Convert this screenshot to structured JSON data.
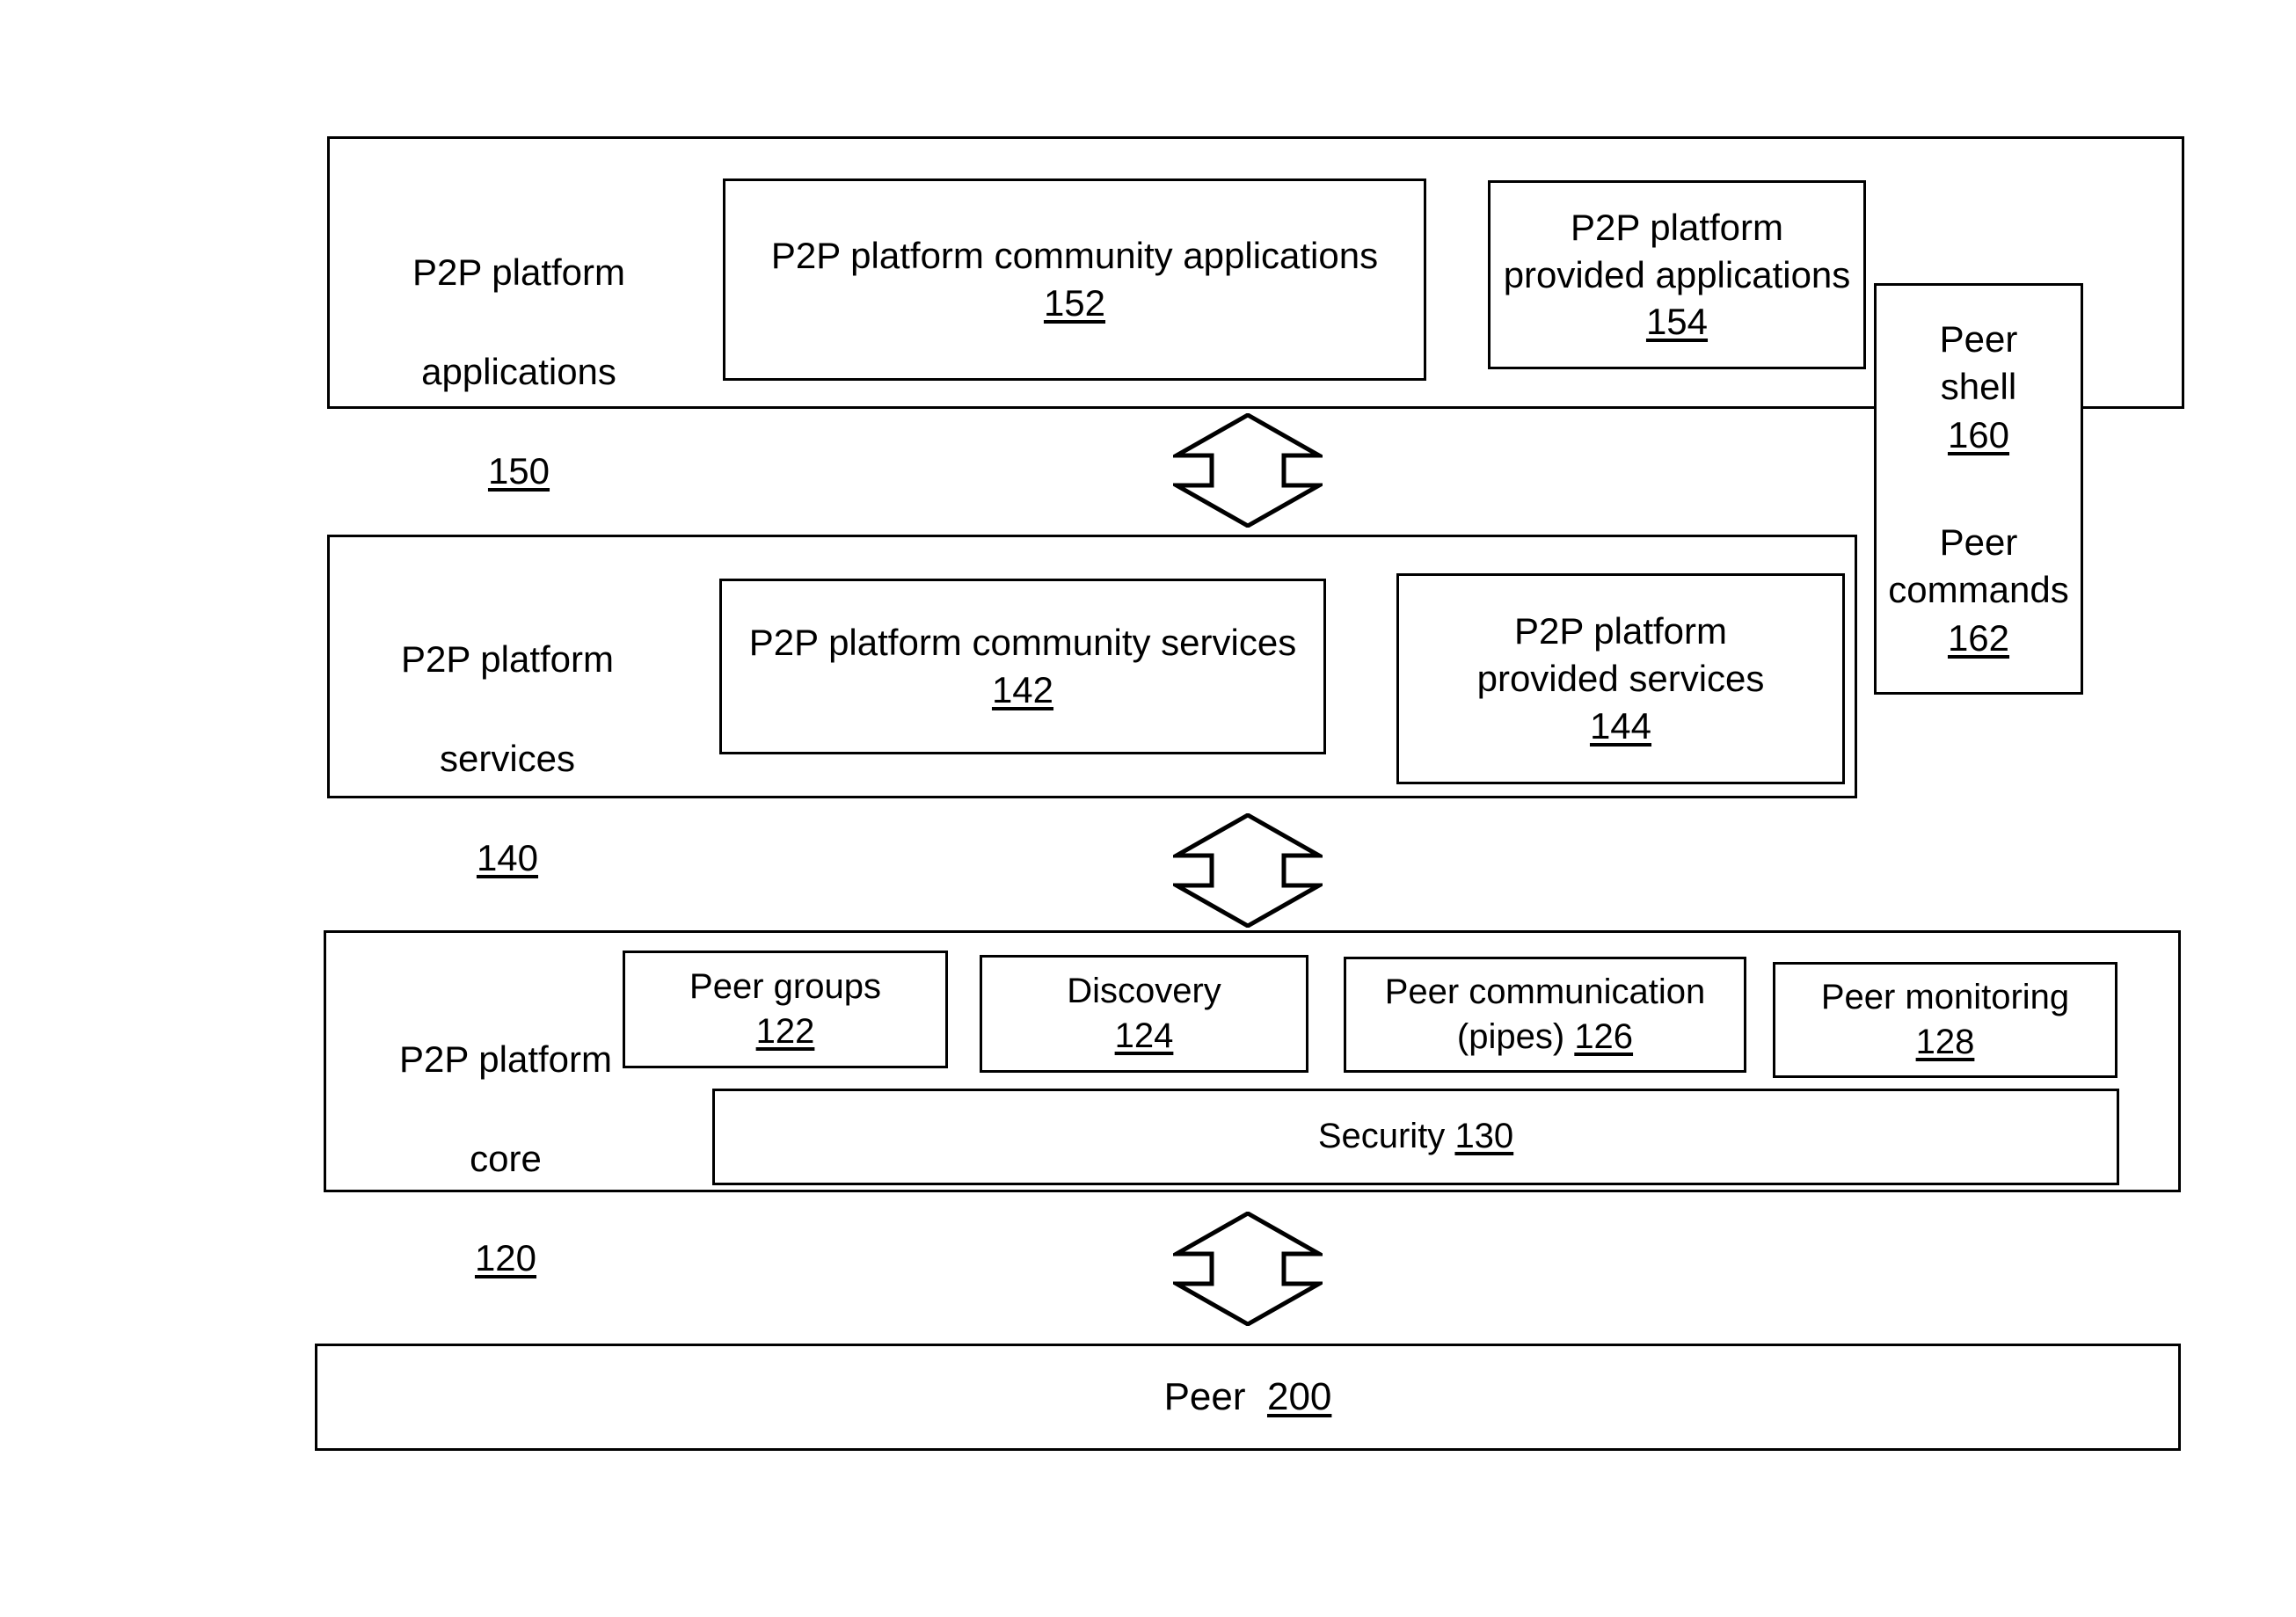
{
  "figure": {
    "type": "layered-architecture-block-diagram",
    "domain": "patent-figure"
  },
  "layers": {
    "applications": {
      "title_line1": "P2P platform",
      "title_line2": "applications",
      "ref": "150",
      "children": [
        {
          "name": "community-applications",
          "label": "P2P platform community applications",
          "ref": "152"
        },
        {
          "name": "provided-applications",
          "label_line1": "P2P platform",
          "label_line2": "provided applications",
          "ref": "154"
        }
      ]
    },
    "services": {
      "title_line1": "P2P platform",
      "title_line2": "services",
      "ref": "140",
      "children": [
        {
          "name": "community-services",
          "label": "P2P platform community services",
          "ref": "142"
        },
        {
          "name": "provided-services",
          "label_line1": "P2P platform",
          "label_line2": "provided services",
          "ref": "144"
        }
      ]
    },
    "core": {
      "title_line1": "P2P platform",
      "title_line2": "core",
      "ref": "120",
      "children": [
        {
          "name": "peer-groups",
          "label": "Peer groups",
          "ref": "122"
        },
        {
          "name": "discovery",
          "label": "Discovery",
          "ref": "124"
        },
        {
          "name": "peer-communication",
          "label_line1": "Peer communication",
          "label_line2": "(pipes)",
          "ref": "126"
        },
        {
          "name": "peer-monitoring",
          "label": "Peer monitoring",
          "ref": "128"
        },
        {
          "name": "security",
          "label": "Security",
          "ref": "130"
        }
      ]
    },
    "peer": {
      "label": "Peer",
      "ref": "200"
    }
  },
  "side_panel": {
    "shell": {
      "line1": "Peer",
      "line2": "shell",
      "ref": "160"
    },
    "commands": {
      "line1": "Peer",
      "line2": "commands",
      "ref": "162"
    }
  },
  "connectors": [
    {
      "name": "applications-services-arrow",
      "kind": "double-headed-vertical-arrow"
    },
    {
      "name": "services-core-arrow",
      "kind": "double-headed-vertical-arrow"
    },
    {
      "name": "core-peer-arrow",
      "kind": "double-headed-vertical-arrow"
    }
  ],
  "colors": {
    "stroke": "#000000",
    "fill": "#ffffff"
  }
}
